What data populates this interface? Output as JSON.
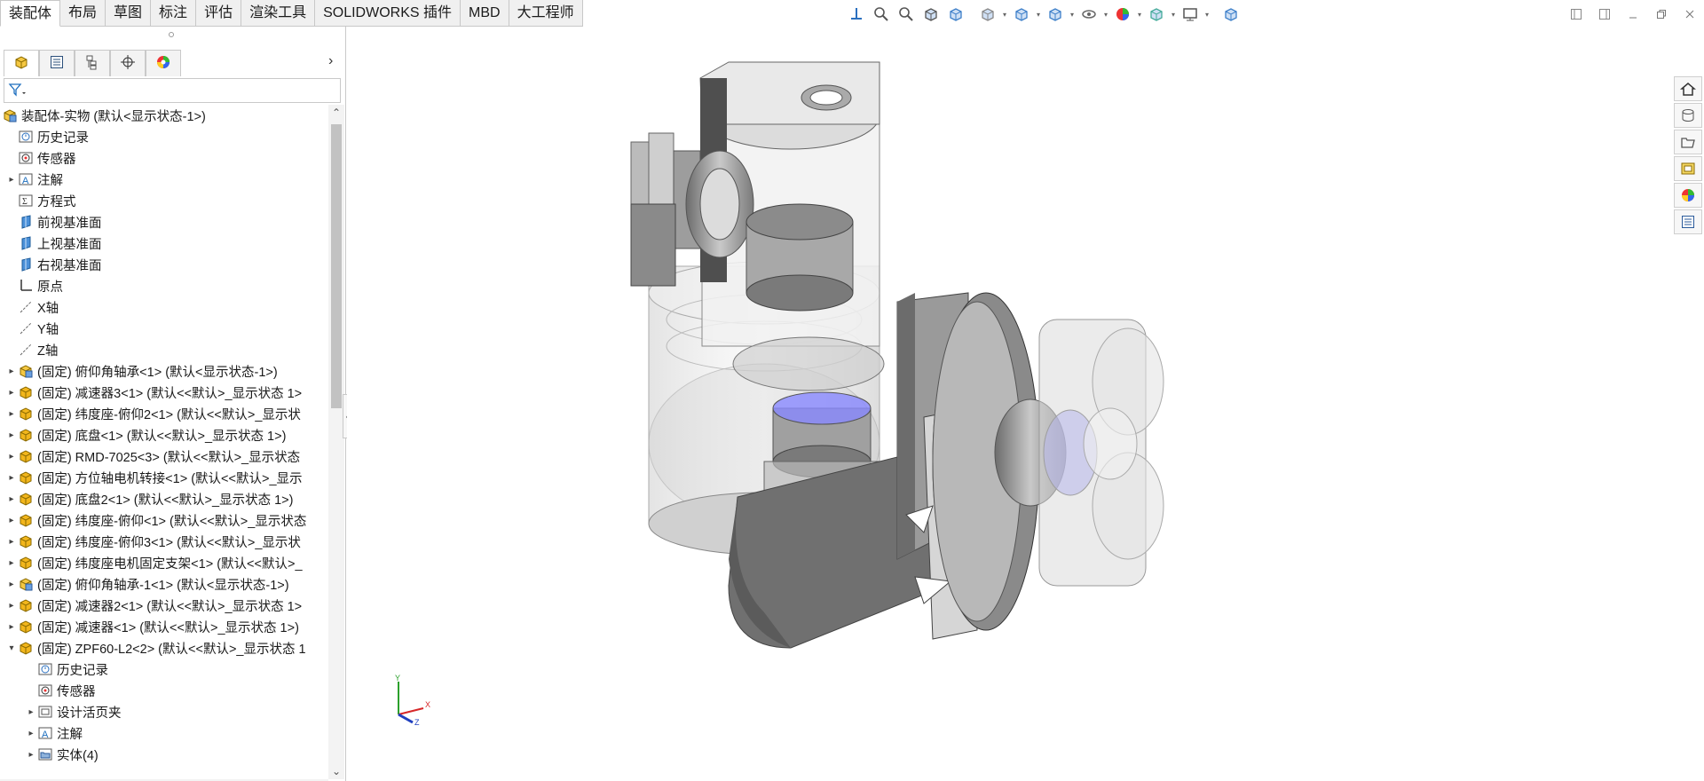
{
  "tabs": [
    {
      "label": "装配体",
      "active": true
    },
    {
      "label": "布局"
    },
    {
      "label": "草图"
    },
    {
      "label": "标注"
    },
    {
      "label": "评估"
    },
    {
      "label": "渲染工具"
    },
    {
      "label": "SOLIDWORKS 插件"
    },
    {
      "label": "MBD"
    },
    {
      "label": "大工程师"
    }
  ],
  "hud_icons": [
    "view-orientation-icon",
    "zoom-to-fit-icon",
    "zoom-to-area-icon",
    "previous-view-icon",
    "section-view-icon",
    "dynamic-annotation-icon",
    "view-orientation-cube-icon",
    "display-style-icon",
    "hide-show-icon",
    "edit-appearance-icon",
    "apply-scene-icon",
    "view-settings-icon",
    "3d-view-icon"
  ],
  "colors": {
    "accent_blue": "#1e6fbf",
    "part_yellow": "#e8a800",
    "model_gray": "#8a8a8a",
    "highlight_violet": "#8888ff",
    "panel_bg": "#f3f3f3"
  },
  "tree": {
    "root": "装配体-实物  (默认<显示状态-1>)",
    "items": [
      {
        "label": "历史记录",
        "icon": "history-icon",
        "indent": 1,
        "expander": ""
      },
      {
        "label": "传感器",
        "icon": "sensor-icon",
        "indent": 1,
        "expander": ""
      },
      {
        "label": "注解",
        "icon": "annotation-icon",
        "indent": 1,
        "expander": "▸"
      },
      {
        "label": "方程式",
        "icon": "equation-icon",
        "indent": 1,
        "expander": ""
      },
      {
        "label": "前视基准面",
        "icon": "plane-icon",
        "indent": 1,
        "expander": ""
      },
      {
        "label": "上视基准面",
        "icon": "plane-icon",
        "indent": 1,
        "expander": ""
      },
      {
        "label": "右视基准面",
        "icon": "plane-icon",
        "indent": 1,
        "expander": ""
      },
      {
        "label": "原点",
        "icon": "origin-icon",
        "indent": 1,
        "expander": ""
      },
      {
        "label": "X轴",
        "icon": "axis-icon",
        "indent": 1,
        "expander": ""
      },
      {
        "label": "Y轴",
        "icon": "axis-icon",
        "indent": 1,
        "expander": ""
      },
      {
        "label": "Z轴",
        "icon": "axis-icon",
        "indent": 1,
        "expander": ""
      },
      {
        "label": "(固定) 俯仰角轴承<1> (默认<显示状态-1>)",
        "icon": "assembly-icon",
        "indent": 1,
        "expander": "▸"
      },
      {
        "label": "(固定) 减速器3<1> (默认<<默认>_显示状态 1>",
        "icon": "part-icon",
        "indent": 1,
        "expander": "▸"
      },
      {
        "label": "(固定) 纬度座-俯仰2<1> (默认<<默认>_显示状",
        "icon": "part-icon",
        "indent": 1,
        "expander": "▸"
      },
      {
        "label": "(固定) 底盘<1> (默认<<默认>_显示状态 1>)",
        "icon": "part-icon",
        "indent": 1,
        "expander": "▸"
      },
      {
        "label": "(固定) RMD-7025<3> (默认<<默认>_显示状态",
        "icon": "part-icon",
        "indent": 1,
        "expander": "▸"
      },
      {
        "label": "(固定) 方位轴电机转接<1> (默认<<默认>_显示",
        "icon": "part-icon",
        "indent": 1,
        "expander": "▸"
      },
      {
        "label": "(固定) 底盘2<1> (默认<<默认>_显示状态 1>)",
        "icon": "part-icon",
        "indent": 1,
        "expander": "▸"
      },
      {
        "label": "(固定) 纬度座-俯仰<1> (默认<<默认>_显示状态",
        "icon": "part-icon",
        "indent": 1,
        "expander": "▸"
      },
      {
        "label": "(固定) 纬度座-俯仰3<1> (默认<<默认>_显示状",
        "icon": "part-icon",
        "indent": 1,
        "expander": "▸"
      },
      {
        "label": "(固定) 纬度座电机固定支架<1> (默认<<默认>_",
        "icon": "part-icon",
        "indent": 1,
        "expander": "▸"
      },
      {
        "label": "(固定) 俯仰角轴承-1<1> (默认<显示状态-1>)",
        "icon": "assembly-icon",
        "indent": 1,
        "expander": "▸"
      },
      {
        "label": "(固定) 减速器2<1> (默认<<默认>_显示状态 1>",
        "icon": "part-icon",
        "indent": 1,
        "expander": "▸"
      },
      {
        "label": "(固定) 减速器<1> (默认<<默认>_显示状态 1>)",
        "icon": "part-icon",
        "indent": 1,
        "expander": "▸"
      },
      {
        "label": "(固定) ZPF60-L2<2> (默认<<默认>_显示状态 1",
        "icon": "part-icon",
        "indent": 1,
        "expander": "▾"
      },
      {
        "label": "历史记录",
        "icon": "history-icon",
        "indent": 2,
        "expander": ""
      },
      {
        "label": "传感器",
        "icon": "sensor-icon",
        "indent": 2,
        "expander": ""
      },
      {
        "label": "设计活页夹",
        "icon": "design-binder-icon",
        "indent": 2,
        "expander": "▸"
      },
      {
        "label": "注解",
        "icon": "annotation-icon",
        "indent": 2,
        "expander": "▸"
      },
      {
        "label": "实体(4)",
        "icon": "folder-icon",
        "indent": 2,
        "expander": "▸"
      }
    ]
  },
  "triad": {
    "x": "X",
    "y": "Y",
    "z": "Z"
  },
  "taskpane": [
    "solidworks-resources-icon",
    "design-library-icon",
    "file-explorer-icon",
    "view-palette-icon",
    "appearances-icon",
    "custom-properties-icon"
  ]
}
